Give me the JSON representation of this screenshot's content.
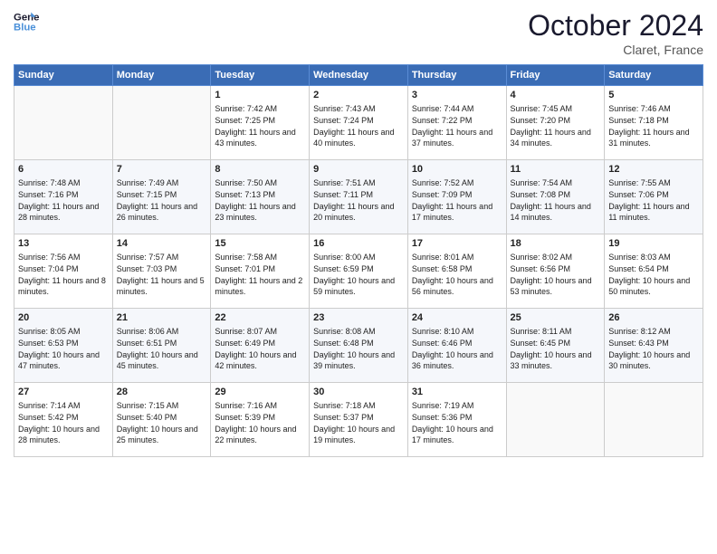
{
  "logo": {
    "line1": "General",
    "line2": "Blue"
  },
  "title": "October 2024",
  "subtitle": "Claret, France",
  "days_header": [
    "Sunday",
    "Monday",
    "Tuesday",
    "Wednesday",
    "Thursday",
    "Friday",
    "Saturday"
  ],
  "weeks": [
    [
      {
        "day": "",
        "sunrise": "",
        "sunset": "",
        "daylight": "",
        "empty": true
      },
      {
        "day": "",
        "sunrise": "",
        "sunset": "",
        "daylight": "",
        "empty": true
      },
      {
        "day": "1",
        "sunrise": "Sunrise: 7:42 AM",
        "sunset": "Sunset: 7:25 PM",
        "daylight": "Daylight: 11 hours and 43 minutes."
      },
      {
        "day": "2",
        "sunrise": "Sunrise: 7:43 AM",
        "sunset": "Sunset: 7:24 PM",
        "daylight": "Daylight: 11 hours and 40 minutes."
      },
      {
        "day": "3",
        "sunrise": "Sunrise: 7:44 AM",
        "sunset": "Sunset: 7:22 PM",
        "daylight": "Daylight: 11 hours and 37 minutes."
      },
      {
        "day": "4",
        "sunrise": "Sunrise: 7:45 AM",
        "sunset": "Sunset: 7:20 PM",
        "daylight": "Daylight: 11 hours and 34 minutes."
      },
      {
        "day": "5",
        "sunrise": "Sunrise: 7:46 AM",
        "sunset": "Sunset: 7:18 PM",
        "daylight": "Daylight: 11 hours and 31 minutes."
      }
    ],
    [
      {
        "day": "6",
        "sunrise": "Sunrise: 7:48 AM",
        "sunset": "Sunset: 7:16 PM",
        "daylight": "Daylight: 11 hours and 28 minutes."
      },
      {
        "day": "7",
        "sunrise": "Sunrise: 7:49 AM",
        "sunset": "Sunset: 7:15 PM",
        "daylight": "Daylight: 11 hours and 26 minutes."
      },
      {
        "day": "8",
        "sunrise": "Sunrise: 7:50 AM",
        "sunset": "Sunset: 7:13 PM",
        "daylight": "Daylight: 11 hours and 23 minutes."
      },
      {
        "day": "9",
        "sunrise": "Sunrise: 7:51 AM",
        "sunset": "Sunset: 7:11 PM",
        "daylight": "Daylight: 11 hours and 20 minutes."
      },
      {
        "day": "10",
        "sunrise": "Sunrise: 7:52 AM",
        "sunset": "Sunset: 7:09 PM",
        "daylight": "Daylight: 11 hours and 17 minutes."
      },
      {
        "day": "11",
        "sunrise": "Sunrise: 7:54 AM",
        "sunset": "Sunset: 7:08 PM",
        "daylight": "Daylight: 11 hours and 14 minutes."
      },
      {
        "day": "12",
        "sunrise": "Sunrise: 7:55 AM",
        "sunset": "Sunset: 7:06 PM",
        "daylight": "Daylight: 11 hours and 11 minutes."
      }
    ],
    [
      {
        "day": "13",
        "sunrise": "Sunrise: 7:56 AM",
        "sunset": "Sunset: 7:04 PM",
        "daylight": "Daylight: 11 hours and 8 minutes."
      },
      {
        "day": "14",
        "sunrise": "Sunrise: 7:57 AM",
        "sunset": "Sunset: 7:03 PM",
        "daylight": "Daylight: 11 hours and 5 minutes."
      },
      {
        "day": "15",
        "sunrise": "Sunrise: 7:58 AM",
        "sunset": "Sunset: 7:01 PM",
        "daylight": "Daylight: 11 hours and 2 minutes."
      },
      {
        "day": "16",
        "sunrise": "Sunrise: 8:00 AM",
        "sunset": "Sunset: 6:59 PM",
        "daylight": "Daylight: 10 hours and 59 minutes."
      },
      {
        "day": "17",
        "sunrise": "Sunrise: 8:01 AM",
        "sunset": "Sunset: 6:58 PM",
        "daylight": "Daylight: 10 hours and 56 minutes."
      },
      {
        "day": "18",
        "sunrise": "Sunrise: 8:02 AM",
        "sunset": "Sunset: 6:56 PM",
        "daylight": "Daylight: 10 hours and 53 minutes."
      },
      {
        "day": "19",
        "sunrise": "Sunrise: 8:03 AM",
        "sunset": "Sunset: 6:54 PM",
        "daylight": "Daylight: 10 hours and 50 minutes."
      }
    ],
    [
      {
        "day": "20",
        "sunrise": "Sunrise: 8:05 AM",
        "sunset": "Sunset: 6:53 PM",
        "daylight": "Daylight: 10 hours and 47 minutes."
      },
      {
        "day": "21",
        "sunrise": "Sunrise: 8:06 AM",
        "sunset": "Sunset: 6:51 PM",
        "daylight": "Daylight: 10 hours and 45 minutes."
      },
      {
        "day": "22",
        "sunrise": "Sunrise: 8:07 AM",
        "sunset": "Sunset: 6:49 PM",
        "daylight": "Daylight: 10 hours and 42 minutes."
      },
      {
        "day": "23",
        "sunrise": "Sunrise: 8:08 AM",
        "sunset": "Sunset: 6:48 PM",
        "daylight": "Daylight: 10 hours and 39 minutes."
      },
      {
        "day": "24",
        "sunrise": "Sunrise: 8:10 AM",
        "sunset": "Sunset: 6:46 PM",
        "daylight": "Daylight: 10 hours and 36 minutes."
      },
      {
        "day": "25",
        "sunrise": "Sunrise: 8:11 AM",
        "sunset": "Sunset: 6:45 PM",
        "daylight": "Daylight: 10 hours and 33 minutes."
      },
      {
        "day": "26",
        "sunrise": "Sunrise: 8:12 AM",
        "sunset": "Sunset: 6:43 PM",
        "daylight": "Daylight: 10 hours and 30 minutes."
      }
    ],
    [
      {
        "day": "27",
        "sunrise": "Sunrise: 7:14 AM",
        "sunset": "Sunset: 5:42 PM",
        "daylight": "Daylight: 10 hours and 28 minutes."
      },
      {
        "day": "28",
        "sunrise": "Sunrise: 7:15 AM",
        "sunset": "Sunset: 5:40 PM",
        "daylight": "Daylight: 10 hours and 25 minutes."
      },
      {
        "day": "29",
        "sunrise": "Sunrise: 7:16 AM",
        "sunset": "Sunset: 5:39 PM",
        "daylight": "Daylight: 10 hours and 22 minutes."
      },
      {
        "day": "30",
        "sunrise": "Sunrise: 7:18 AM",
        "sunset": "Sunset: 5:37 PM",
        "daylight": "Daylight: 10 hours and 19 minutes."
      },
      {
        "day": "31",
        "sunrise": "Sunrise: 7:19 AM",
        "sunset": "Sunset: 5:36 PM",
        "daylight": "Daylight: 10 hours and 17 minutes."
      },
      {
        "day": "",
        "sunrise": "",
        "sunset": "",
        "daylight": "",
        "empty": true
      },
      {
        "day": "",
        "sunrise": "",
        "sunset": "",
        "daylight": "",
        "empty": true
      }
    ]
  ]
}
